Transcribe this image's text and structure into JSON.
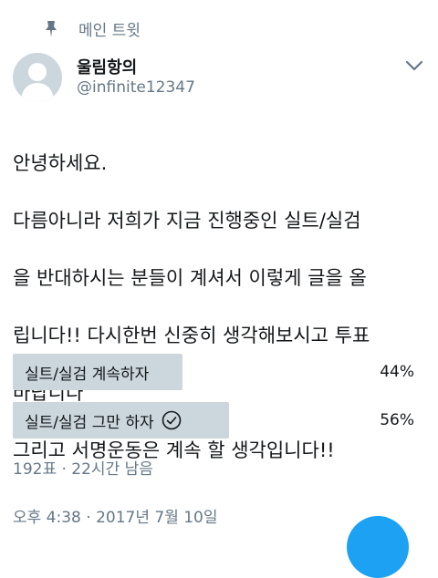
{
  "header": {
    "pinned_label": "메인 트윗",
    "pin_icon": "pin-icon"
  },
  "author": {
    "display_name": "울림항의",
    "handle": "@infinite12347",
    "avatar_icon": "default-avatar-icon"
  },
  "menu_icon": "chevron-down-icon",
  "tweet": {
    "lines": [
      "안녕하세요.",
      "다름아니라 저희가 지금 진행중인 실트/실검",
      "을 반대하시는 분들이 계셔서 이렇게 글을 올",
      "립니다!! 다시한번 신중히 생각해보시고 투표",
      "바랍니다^^",
      "그리고 서명운동은 계속 할 생각입니다!!"
    ]
  },
  "poll": {
    "options": [
      {
        "label": "실트/실검 계속하자",
        "percent_label": "44%",
        "value": 44,
        "selected": false
      },
      {
        "label": "실트/실검 그만 하자",
        "percent_label": "56%",
        "value": 56,
        "selected": true
      }
    ],
    "meta": "192표 · 22시간 남음"
  },
  "timestamp": "오후 4:38 · 2017년 7월 10일",
  "colors": {
    "bar": "#ccd6dd",
    "secondary_text": "#657786",
    "accent": "#1da1f2"
  }
}
